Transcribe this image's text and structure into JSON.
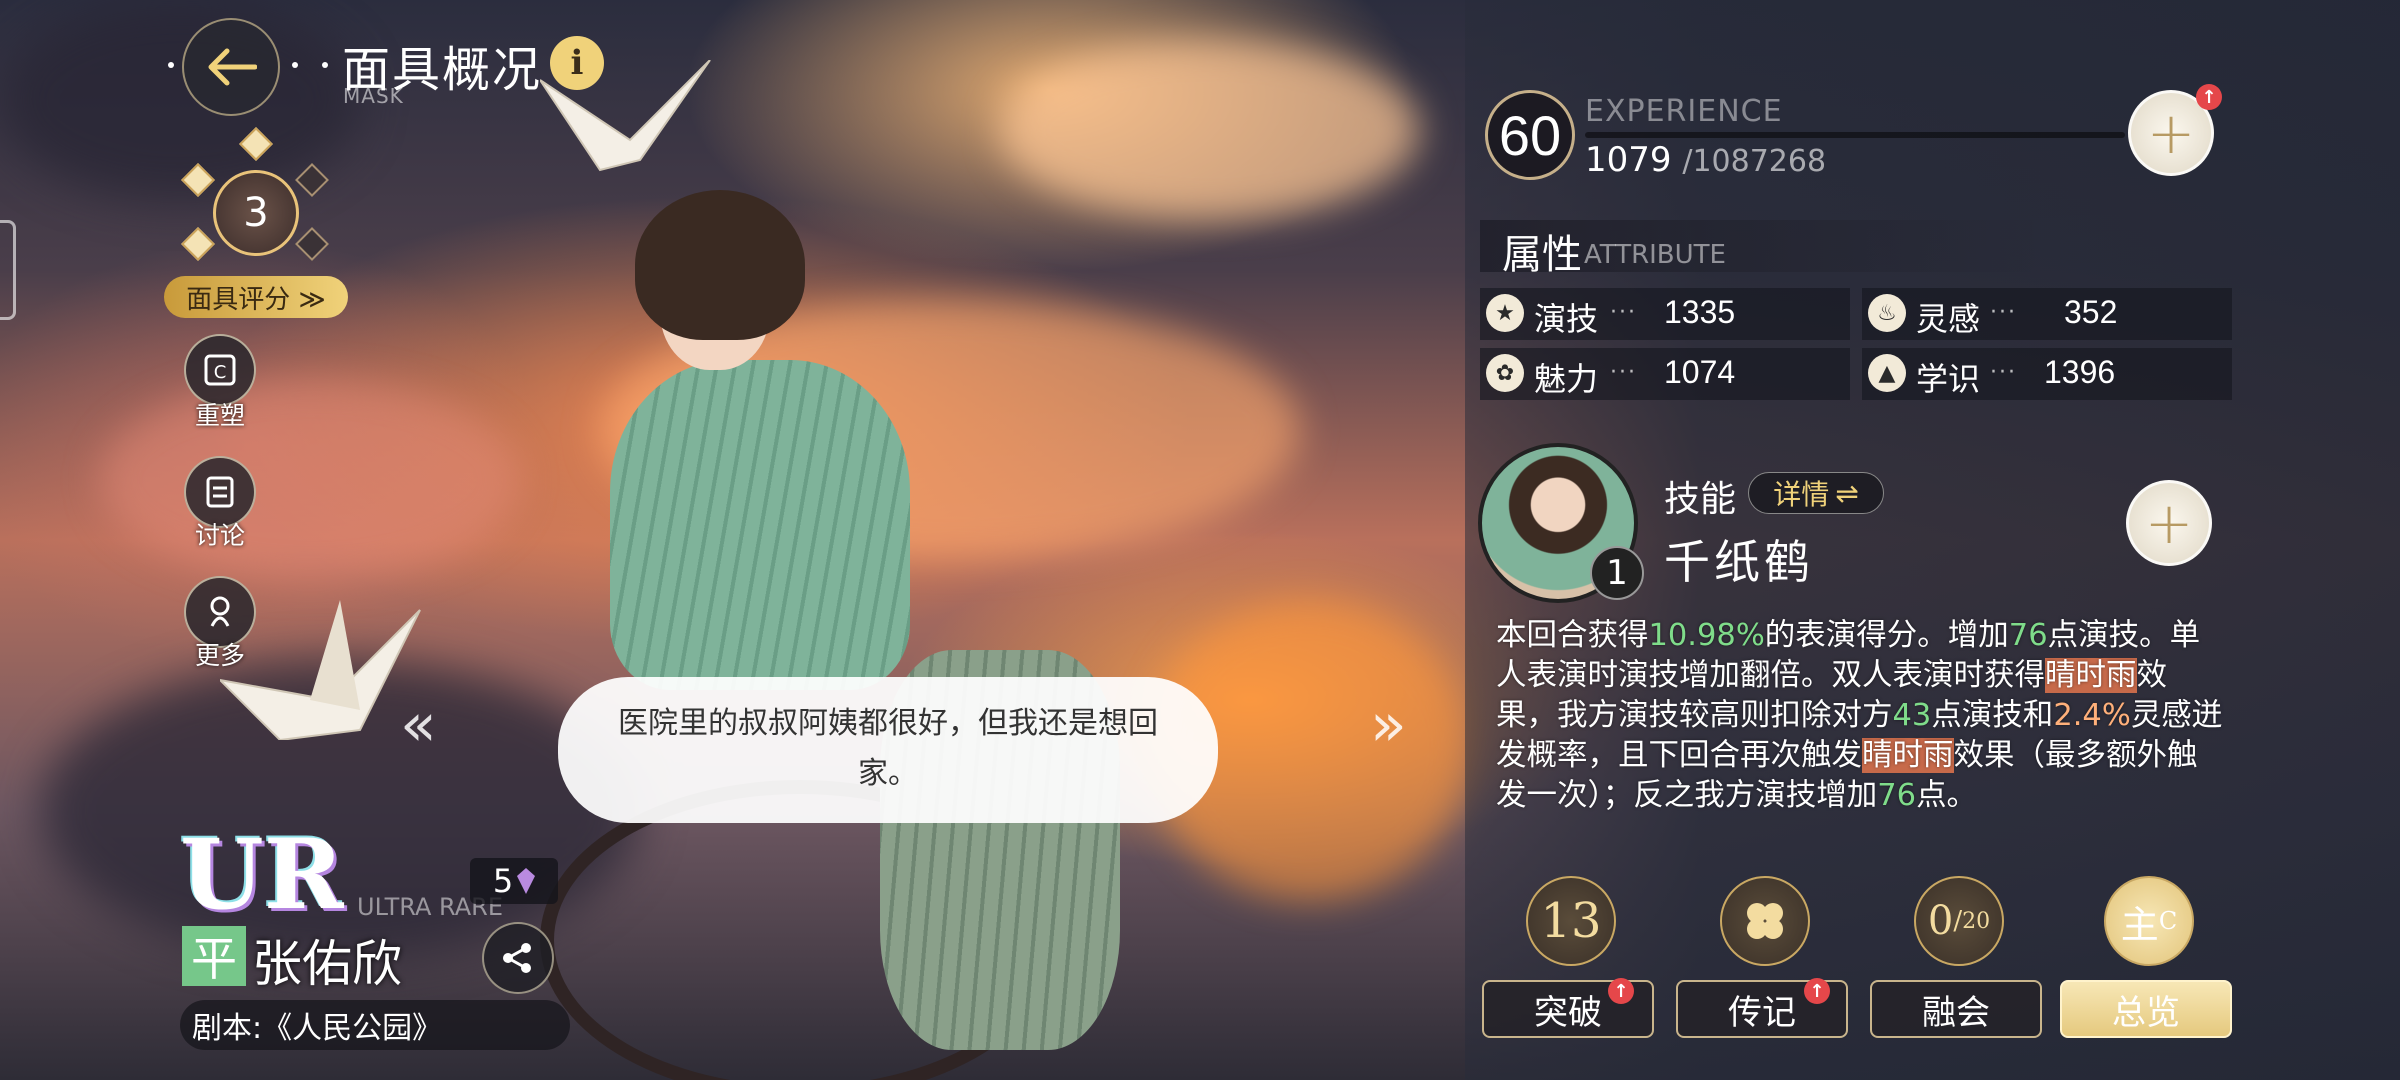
{
  "header": {
    "title": "面具概况",
    "subtitle": "MASK",
    "back_icon": "back-arrow-icon",
    "info_label": "i"
  },
  "rating": {
    "value": "3",
    "filled_stars": 3,
    "total_stars": 5,
    "button_label": "面具评分 ≫"
  },
  "side_menu": [
    {
      "label": "重塑",
      "icon": "reshape-icon"
    },
    {
      "label": "讨论",
      "icon": "discussion-icon"
    },
    {
      "label": "更多",
      "icon": "more-icon"
    }
  ],
  "card": {
    "rarity": "UR",
    "rarity_sub": "ULTRA RARE",
    "rank": "5",
    "tier_badge": "平",
    "name": "张佑欣",
    "script": "剧本:《人民公园》"
  },
  "dialogue": {
    "text": "医院里的叔叔阿姨都很好，但我还是想回家。"
  },
  "experience": {
    "level": "60",
    "label": "EXPERIENCE",
    "current": "1079",
    "max": "/1087268",
    "progress": 0.001
  },
  "attributes": {
    "title": "属性",
    "subtitle": "ATTRIBUTE",
    "items": [
      {
        "name": "演技",
        "value": "1335",
        "icon": "star-icon"
      },
      {
        "name": "灵感",
        "value": "352",
        "icon": "flame-icon"
      },
      {
        "name": "魅力",
        "value": "1074",
        "icon": "charm-icon"
      },
      {
        "name": "学识",
        "value": "1396",
        "icon": "graduation-cap-icon"
      }
    ]
  },
  "skill": {
    "label": "技能",
    "detail_label": "详情",
    "name": "千纸鹤",
    "level": "1",
    "desc_1": "本回合获得",
    "desc_g1": "10.98%",
    "desc_2": "的表演得分。增加",
    "desc_g2": "76",
    "desc_3": "点演技。单人表演时演技增加翻倍。双人表演时获得",
    "desc_o1": "晴时雨",
    "desc_4": "效果，我方演技较高则扣除对方",
    "desc_g3": "43",
    "desc_5": "点演技和",
    "desc_g4": "2.4%",
    "desc_6": "灵感迸发概率，且下回合再次触发",
    "desc_o2": "晴时雨",
    "desc_7": "效果（最多额外触发一次）；反之我方演技增加",
    "desc_g5": "76",
    "desc_8": "点。"
  },
  "bottom_icons": [
    {
      "value": "13"
    },
    {
      "value": ""
    },
    {
      "value": "0",
      "sub": "20"
    },
    {
      "value": "主",
      "sub": "C"
    }
  ],
  "tabs": [
    {
      "label": "突破",
      "badge": true
    },
    {
      "label": "传记",
      "badge": true
    },
    {
      "label": "融会",
      "badge": false
    },
    {
      "label": "总览",
      "badge": false,
      "active": true
    }
  ],
  "nav": {
    "prev": "«",
    "next": "»"
  },
  "colors": {
    "accent_gold": "#f0d27a",
    "highlight_green": "#7fdc8a",
    "highlight_orange": "#c76a4a",
    "badge_red": "#e5474a"
  }
}
